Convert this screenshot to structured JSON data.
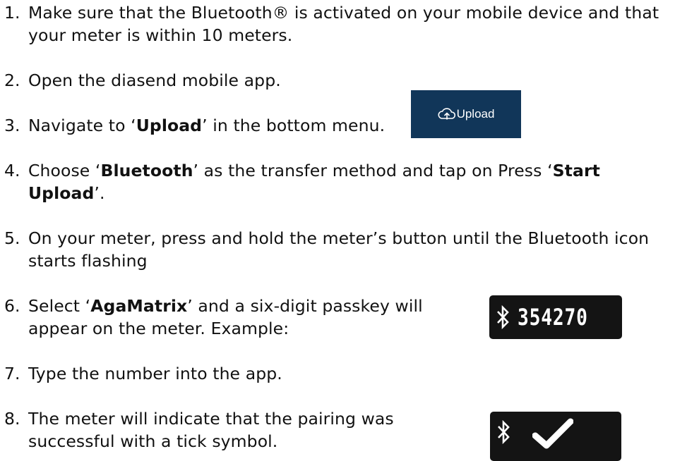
{
  "steps": [
    {
      "number": "1.",
      "line1": "Make sure that the Bluetooth® is activated on your mobile device and that",
      "line2": "your meter is within 10 meters."
    },
    {
      "number": "2.",
      "line1": "Open the diasend mobile app."
    },
    {
      "number": "3.",
      "pre": "Navigate to ‘",
      "bold": "Upload",
      "post": "’ in the bottom menu."
    },
    {
      "number": "4.",
      "pre": "Choose ‘",
      "bold": "Bluetooth",
      "mid": "’ as the transfer method and tap on Press ‘",
      "bold2": "Start",
      "bold2b": "Upload",
      "post": "’."
    },
    {
      "number": "5.",
      "line1": "On your meter, press and hold the meter’s button until the Bluetooth icon",
      "line2": "starts flashing"
    },
    {
      "number": "6.",
      "pre": "Select ‘",
      "bold": "AgaMatrix",
      "post": "’ and a six-digit passkey will",
      "line2": "appear on the meter. Example:"
    },
    {
      "number": "7.",
      "line1": "Type the number into the app."
    },
    {
      "number": "8.",
      "line1": "The meter will indicate that the pairing was",
      "line2": "successful with a tick symbol."
    }
  ],
  "upload_thumbnail": {
    "label": "Upload",
    "icon": "cloud-upload-icon",
    "background": "#113659"
  },
  "meter_passkey": {
    "icon": "bluetooth-icon",
    "passkey": "354270",
    "background": "#141414"
  },
  "meter_success": {
    "icon": "bluetooth-icon",
    "status_icon": "checkmark-icon"
  }
}
